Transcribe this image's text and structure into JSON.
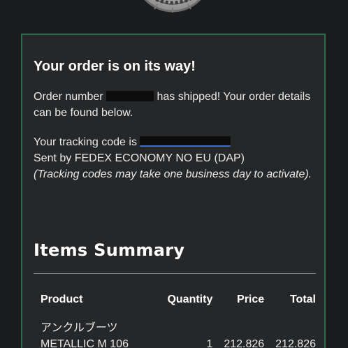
{
  "logo": {
    "icon": "shop-seal-icon"
  },
  "message": {
    "headline": "Your order is on its way!",
    "order_prefix": "Order number",
    "order_suffix": "has shipped! Your order details can be found below.",
    "tracking_prefix": "Your tracking code is",
    "sent_by": "Sent by FEDEX ECONOMY NO EU (DAP)",
    "tracking_note": "(Tracking codes may take one business day to activate)."
  },
  "summary": {
    "title": "Items Summary",
    "columns": [
      "Product",
      "Quantity",
      "Price",
      "Total"
    ],
    "items": [
      {
        "name_line1": "アンクルブーツ",
        "name_line2": "METALLIC M 106",
        "quantity": "1",
        "price": "212.826",
        "total": "212.826"
      }
    ]
  },
  "colors": {
    "card_border": "#2f6b50",
    "link": "#3a6fd8",
    "background": "#1b1c1e"
  }
}
